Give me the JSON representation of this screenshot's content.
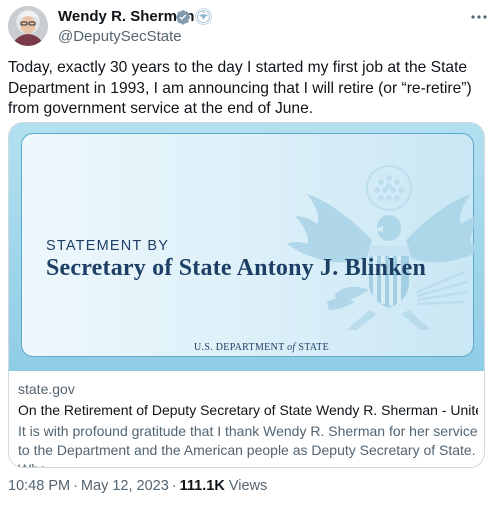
{
  "author": {
    "name": "Wendy R. Sherman",
    "handle": "@DeputySecState",
    "verified_color": "#829aab"
  },
  "tweet": {
    "text": "Today, exactly 30 years to the day I started my first job at the State Department in 1993, I am announcing that I will retire (or “re-retire”) from government service at the end of June."
  },
  "card": {
    "image": {
      "statement_by": "STATEMENT BY",
      "headline": "Secretary of State Antony J. Blinken",
      "dept_prefix": "U.S. DEPARTMENT",
      "dept_of": "of",
      "dept_suffix": "STATE"
    },
    "domain": "state.gov",
    "title": "On the Retirement of Deputy Secretary of State Wendy R. Sherman - United ...",
    "description": "It is with profound gratitude that I thank Wendy R. Sherman for her service to the Department and the American people as Deputy Secretary of State. Whe..."
  },
  "meta": {
    "time": "10:48 PM",
    "date": "May 12, 2023",
    "views_count": "111.1K",
    "views_label": "Views",
    "separator": "·"
  },
  "icons": {
    "verified": "verified-badge-icon",
    "affiliation": "state-department-seal-icon",
    "more": "more-options-icon"
  },
  "colors": {
    "text_primary": "#0f1419",
    "text_secondary": "#536471",
    "card_border": "#cfd9de",
    "seal_blue": "#1d3f66"
  }
}
